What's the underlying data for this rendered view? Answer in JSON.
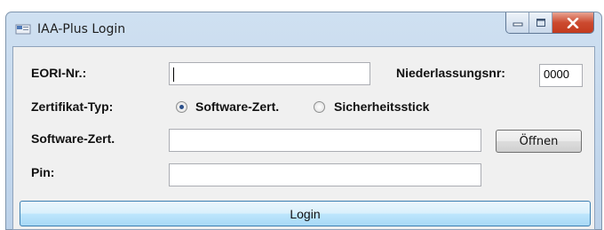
{
  "window": {
    "title": "IAA-Plus Login",
    "minimize_glyph": "▭",
    "maximize_glyph": "▫",
    "close_glyph": "✕"
  },
  "form": {
    "eori": {
      "label": "EORI-Nr.:",
      "value": ""
    },
    "niederlassung": {
      "label": "Niederlassungsnr:",
      "value": "0000"
    },
    "zertifikat_typ": {
      "label": "Zertifikat-Typ:",
      "options": [
        {
          "label": "Software-Zert.",
          "selected": true
        },
        {
          "label": "Sicherheitsstick",
          "selected": false
        }
      ]
    },
    "software_zert": {
      "label": "Software-Zert.",
      "value": "",
      "button": "Öffnen"
    },
    "pin": {
      "label": "Pin:",
      "value": ""
    }
  },
  "login_button": "Login",
  "colors": {
    "titlebar": "#c4d8ee",
    "close_button": "#c94a30",
    "login_button": "#bee6fd",
    "client_bg": "#f0f0f0"
  }
}
